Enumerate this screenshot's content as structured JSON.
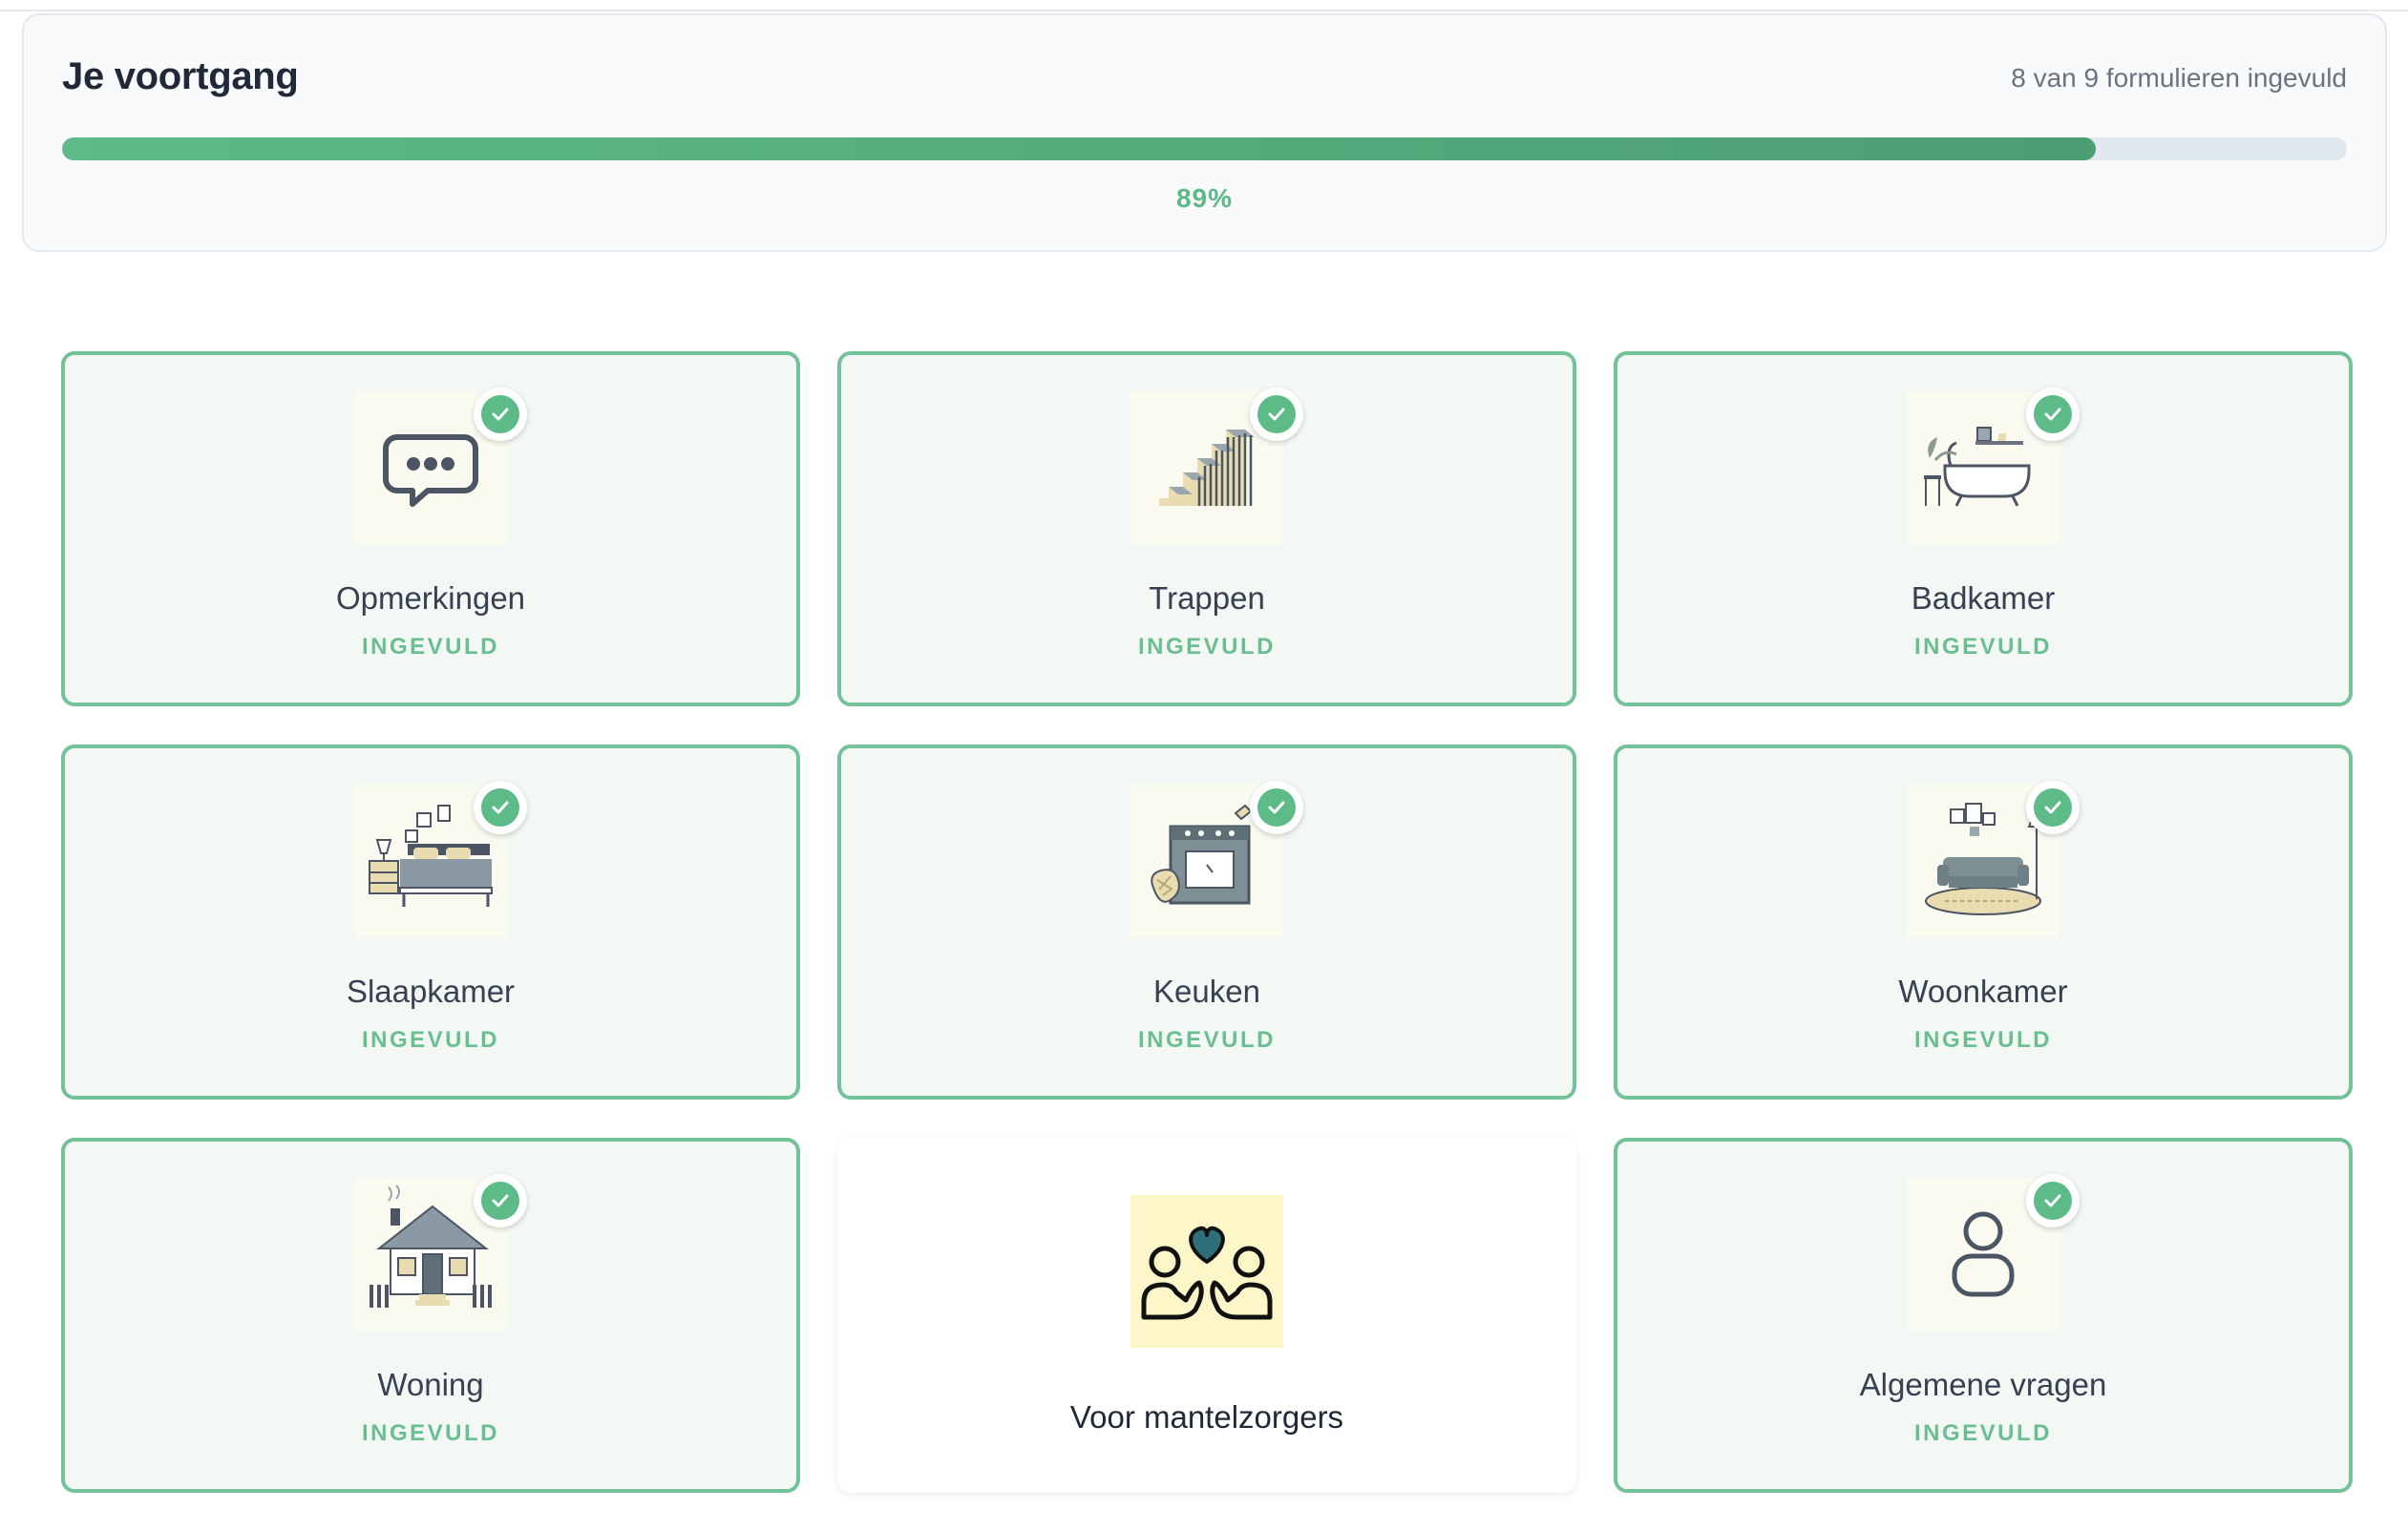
{
  "progress": {
    "title": "Je voortgang",
    "count_text": "8 van 9 formulieren ingevuld",
    "percent_text": "89%",
    "fraction": 0.89,
    "bar_color": "#5cbb86"
  },
  "status_done": "INGEVULD",
  "colors": {
    "accent": "#5cbb86",
    "card_border": "#72c29a",
    "card_bg": "#f3f8f4"
  },
  "forms": [
    {
      "title": "Opmerkingen",
      "status": "INGEVULD",
      "icon": "speech-bubble-icon"
    },
    {
      "title": "Trappen",
      "status": "INGEVULD",
      "icon": "stairs-icon"
    },
    {
      "title": "Badkamer",
      "status": "INGEVULD",
      "icon": "bathtub-icon"
    },
    {
      "title": "Slaapkamer",
      "status": "INGEVULD",
      "icon": "bed-icon"
    },
    {
      "title": "Keuken",
      "status": "INGEVULD",
      "icon": "oven-icon"
    },
    {
      "title": "Woonkamer",
      "status": "INGEVULD",
      "icon": "sofa-icon"
    },
    {
      "title": "Woning",
      "status": "INGEVULD",
      "icon": "house-icon"
    },
    {
      "title": "Voor mantelzorgers",
      "status": "",
      "icon": "caregivers-heart-icon"
    },
    {
      "title": "Algemene vragen",
      "status": "INGEVULD",
      "icon": "person-icon"
    }
  ]
}
